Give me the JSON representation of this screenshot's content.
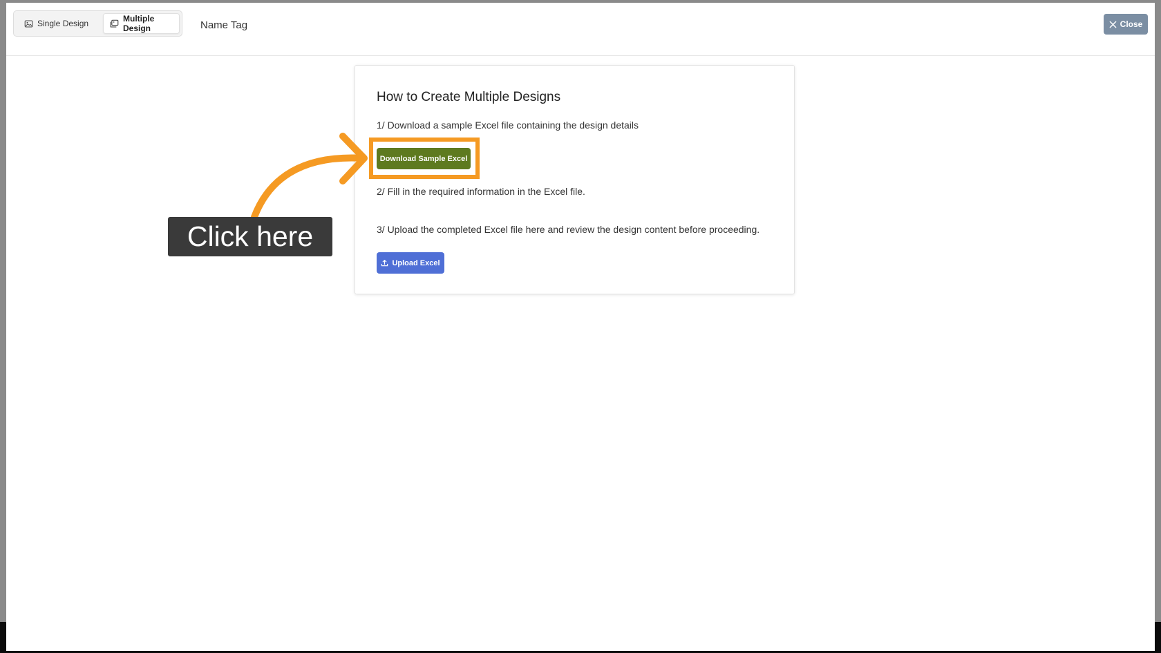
{
  "header": {
    "tabs": [
      {
        "label": "Single Design",
        "icon": "image-icon",
        "active": false
      },
      {
        "label": "Multiple Design",
        "icon": "images-icon",
        "active": true
      }
    ],
    "title": "Name Tag",
    "close_label": "Close"
  },
  "card": {
    "title": "How to Create Multiple Designs",
    "step1": "1/ Download a sample Excel file containing the design details",
    "download_label": "Download Sample Excel",
    "step2": "2/ Fill in the required information in the Excel file.",
    "step3": "3/ Upload the completed Excel file here and review the design content before proceeding.",
    "upload_label": "Upload Excel"
  },
  "annotation": {
    "callout_text": "Click here",
    "highlight_color": "#f59a23"
  },
  "colors": {
    "download_button": "#5e7a1f",
    "upload_button": "#4f6fd6",
    "close_button": "#7b8ea3"
  }
}
